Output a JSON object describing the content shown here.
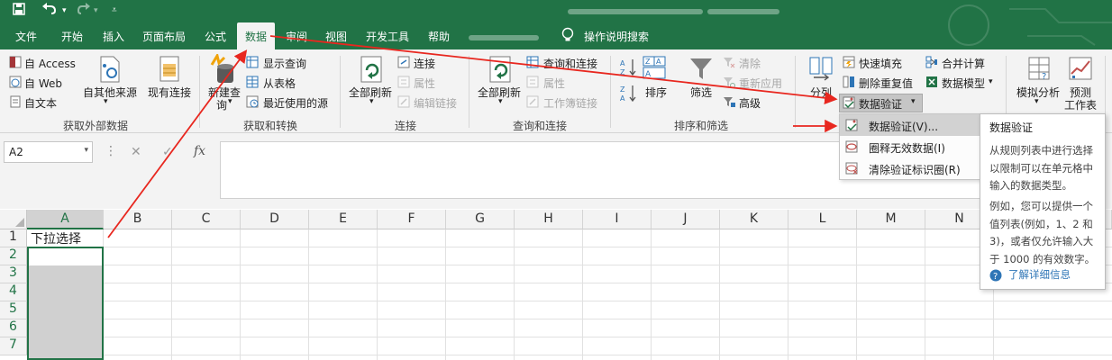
{
  "title_bar": {
    "save": "save",
    "undo": "undo",
    "redo": "redo",
    "customize": "customize"
  },
  "menu": {
    "tabs": [
      "文件",
      "开始",
      "插入",
      "页面布局",
      "公式",
      "数据",
      "审阅",
      "视图",
      "开发工具",
      "帮助"
    ],
    "active": "数据",
    "tell_me": "操作说明搜索"
  },
  "ribbon": {
    "get_external": {
      "from_access": "自 Access",
      "from_web": "自 Web",
      "from_text": "自文本",
      "from_other": "自其他来源",
      "existing": "现有连接",
      "label": "获取和转换",
      "group_label": "获取外部数据"
    },
    "get_transform": {
      "new_query_1": "新建查",
      "new_query_2": "询",
      "show_queries": "显示查询",
      "from_table": "从表格",
      "recent_sources": "最近使用的源",
      "group_label": "获取和转换"
    },
    "connections": {
      "refresh_all": "全部刷新",
      "connections": "连接",
      "properties": "属性",
      "edit_links": "编辑链接",
      "group_label": "连接"
    },
    "queries": {
      "refresh_all": "全部刷新",
      "queries_connections": "查询和连接",
      "properties": "属性",
      "workbook_links": "工作簿链接",
      "group_label": "查询和连接"
    },
    "sort_filter": {
      "sort": "排序",
      "filter": "筛选",
      "clear": "清除",
      "reapply": "重新应用",
      "advanced": "高级",
      "group_label": "排序和筛选"
    },
    "data_tools": {
      "split": "分列",
      "flash_fill": "快速填充",
      "remove_duplicates": "删除重复值",
      "data_validation": "数据验证",
      "consolidate": "合并计算",
      "data_model": "数据模型"
    },
    "forecast": {
      "what_if": "模拟分析",
      "forecast_1": "预测",
      "forecast_2": "工作表"
    }
  },
  "formula_bar": {
    "name_box": "A2",
    "fx": "fx",
    "cancel": "✕",
    "enter": "✓"
  },
  "grid": {
    "columns": [
      "A",
      "B",
      "C",
      "D",
      "E",
      "F",
      "G",
      "H",
      "I",
      "J",
      "K",
      "L",
      "M",
      "N"
    ],
    "rows": [
      "1",
      "2",
      "3",
      "4",
      "5",
      "6",
      "7"
    ],
    "a1": "下拉选择"
  },
  "dropdown": {
    "items": [
      "数据验证(V)...",
      "圈释无效数据(I)",
      "清除验证标识圈(R)"
    ]
  },
  "tooltip": {
    "title": "数据验证",
    "body1": "从规则列表中进行选择以限制可以在单元格中输入的数据类型。",
    "body2": "例如，您可以提供一个值列表(例如，1、2 和 3)，或者仅允许输入大于 1000 的有效数字。",
    "link": "了解详细信息"
  },
  "colors": {
    "excel_green": "#217346",
    "arrow_red": "#e8271f"
  }
}
